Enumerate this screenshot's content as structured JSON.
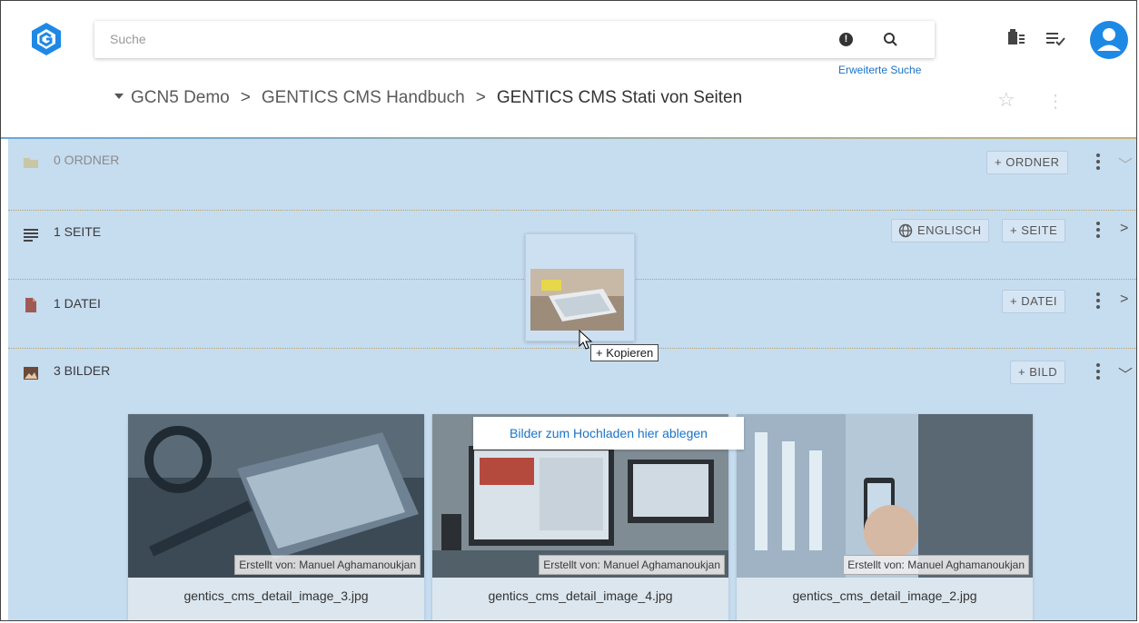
{
  "search": {
    "placeholder": "Suche",
    "advanced_link": "Erweiterte Suche"
  },
  "header_icons": [
    "clipboard-icon",
    "checklist-icon",
    "user-avatar-icon"
  ],
  "breadcrumb": {
    "items": [
      "GCN5 Demo",
      "GENTICS CMS Handbuch",
      "GENTICS CMS Stati von Seiten"
    ]
  },
  "sections": {
    "folders": {
      "label": "0 ORDNER",
      "add_button": "+ ORDNER"
    },
    "pages": {
      "label": "1 SEITE",
      "language_button": "ENGLISCH",
      "add_button": "+ SEITE"
    },
    "files": {
      "label": "1 DATEI",
      "add_button": "+ DATEI"
    },
    "images": {
      "label": "3 BILDER",
      "add_button": "+ BILD"
    }
  },
  "drop_hint": "Bilder zum Hochladen hier ablegen",
  "drag_tooltip": "+ Kopieren",
  "images": [
    {
      "creator": "Erstellt von: Manuel Aghamanoukjan",
      "filename": "gentics_cms_detail_image_3.jpg"
    },
    {
      "creator": "Erstellt von: Manuel Aghamanoukjan",
      "filename": "gentics_cms_detail_image_4.jpg"
    },
    {
      "creator": "Erstellt von: Manuel Aghamanoukjan",
      "filename": "gentics_cms_detail_image_2.jpg"
    }
  ],
  "colors": {
    "accent": "#1e88e5",
    "drop_background": "#c6dcef",
    "link": "#1a73c6"
  }
}
